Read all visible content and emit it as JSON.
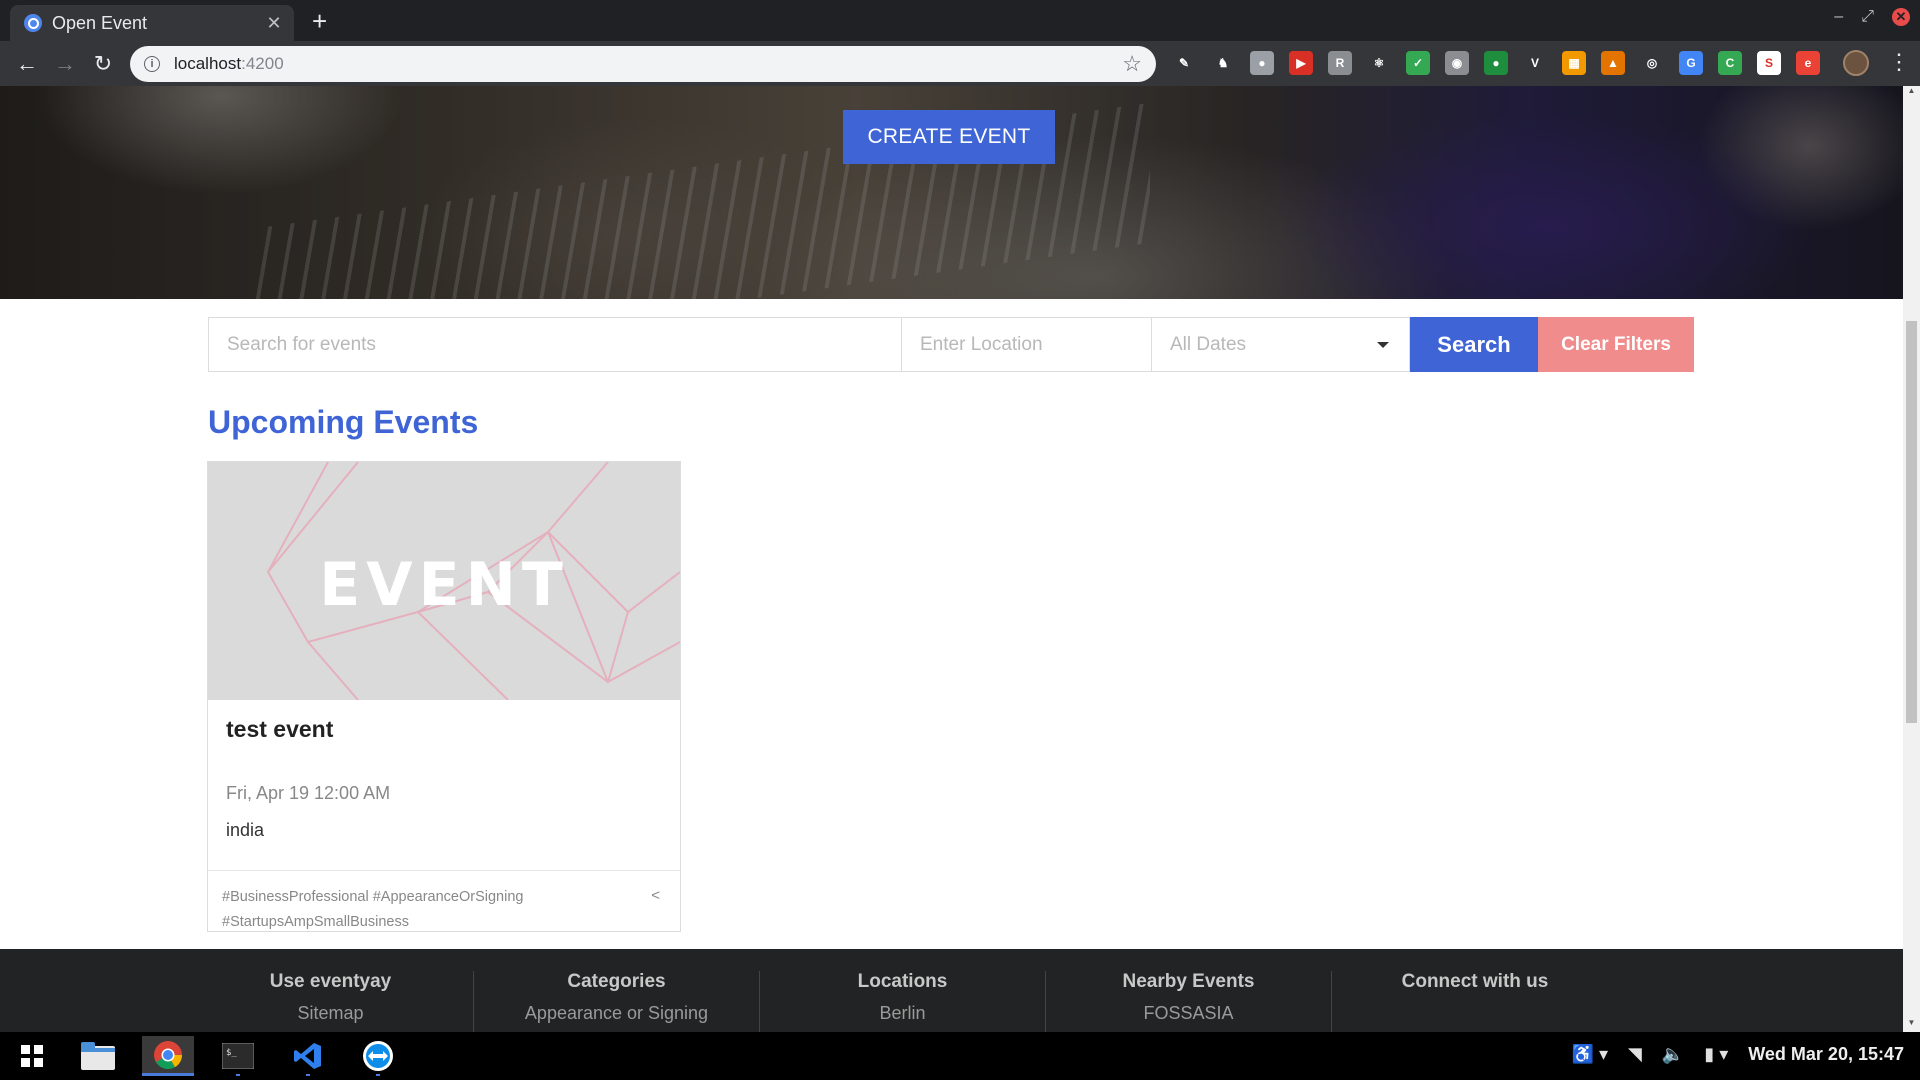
{
  "browser": {
    "tab_title": "Open Event",
    "tab_close": "✕",
    "new_tab": "+",
    "url_host": "localhost",
    "url_port": ":4200",
    "extensions": [
      {
        "icon": "pen-extension-icon",
        "bg": "#35363a",
        "glyph": "✎"
      },
      {
        "icon": "gnome-extension-icon",
        "bg": "#35363a",
        "glyph": "♞"
      },
      {
        "icon": "mask-extension-icon",
        "bg": "#9aa0a6",
        "glyph": "●"
      },
      {
        "icon": "media-extension-icon",
        "bg": "#d93025",
        "glyph": "▶"
      },
      {
        "icon": "tab-extension-icon",
        "bg": "#8a8d91",
        "glyph": "R"
      },
      {
        "icon": "react-extension-icon",
        "bg": "#35363a",
        "glyph": "⚛"
      },
      {
        "icon": "check-extension-icon",
        "bg": "#34a853",
        "glyph": "✓"
      },
      {
        "icon": "camera-extension-icon",
        "bg": "#8a8d91",
        "glyph": "◉"
      },
      {
        "icon": "green-dot-extension-icon",
        "bg": "#1e8e3e",
        "glyph": "●"
      },
      {
        "icon": "vue-extension-icon",
        "bg": "#35363a",
        "glyph": "V"
      },
      {
        "icon": "image-extension-icon",
        "bg": "#f29900",
        "glyph": "▦"
      },
      {
        "icon": "fire-extension-icon",
        "bg": "#e37400",
        "glyph": "▲"
      },
      {
        "icon": "target-extension-icon",
        "bg": "#35363a",
        "glyph": "◎"
      },
      {
        "icon": "translate-extension-icon",
        "bg": "#4285f4",
        "glyph": "G"
      },
      {
        "icon": "cors-extension-icon",
        "bg": "#34a853",
        "glyph": "C"
      },
      {
        "icon": "sh-extension-icon",
        "bg": "#ffffff",
        "glyph": "S"
      },
      {
        "icon": "e-extension-icon",
        "bg": "#ea4335",
        "glyph": "e"
      }
    ]
  },
  "hero": {
    "create_button": "CREATE EVENT"
  },
  "search": {
    "events_placeholder": "Search for events",
    "location_placeholder": "Enter Location",
    "dates_value": "All Dates",
    "search_button": "Search",
    "clear_button": "Clear Filters"
  },
  "section": {
    "title": "Upcoming Events"
  },
  "events": [
    {
      "image_text": "EVENT",
      "title": "test event",
      "date": "Fri, Apr 19 12:00 AM",
      "location": "india",
      "tags": "#BusinessProfessional #AppearanceOrSigning #StartupsAmpSmallBusiness"
    }
  ],
  "footer": {
    "columns": [
      {
        "heading": "Use eventyay",
        "item": "Sitemap"
      },
      {
        "heading": "Categories",
        "item": "Appearance or Signing"
      },
      {
        "heading": "Locations",
        "item": "Berlin"
      },
      {
        "heading": "Nearby Events",
        "item": "FOSSASIA"
      },
      {
        "heading": "Connect with us",
        "item": ""
      }
    ]
  },
  "taskbar": {
    "clock": "Wed Mar 20, 15:47"
  },
  "colors": {
    "accent": "#3e64d6",
    "clear_button": "#f08c8c",
    "footer_bg": "#222324"
  }
}
